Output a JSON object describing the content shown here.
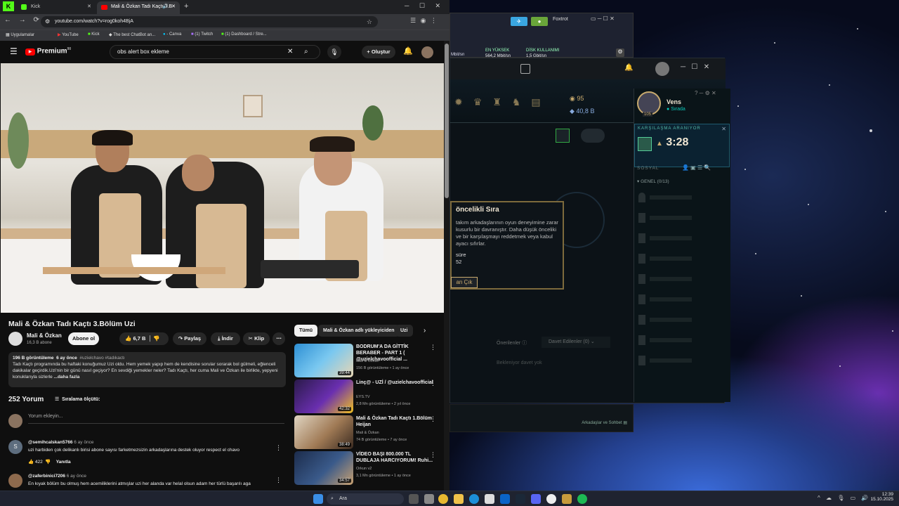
{
  "browser": {
    "tabs": [
      {
        "label": "Kick"
      },
      {
        "label": "Mali & Özkan Tadı Kaçtı 3.B"
      }
    ],
    "url": "youtube.com/watch?v=rog0koh4BjA",
    "bookmarks": [
      "Uygulamalar",
      "YouTube",
      "Kick",
      "The best ChatBot an...",
      "- Canva",
      "(1) Twitch",
      "(1) Dashboard / Stre..."
    ]
  },
  "yt": {
    "logo": "Premium",
    "logo_sup": "90",
    "search_value": "obs alert box ekleme",
    "create_label": "Oluştur",
    "video_title": "Mali & Özkan Tadı Kaçtı 3.Bölüm Uzi",
    "channel": "Mali & Özkan",
    "subs": "16,3 B abone",
    "subscribe": "Abone ol",
    "likes": "6,7 B",
    "share": "Paylaş",
    "download": "İndir",
    "clip": "Klip",
    "desc_views": "196 B görüntüleme",
    "desc_date": "6 ay önce",
    "desc_tags": "#uzielchavo #tadıkactı",
    "desc_text": "Tadı Kaçtı programında bu haftaki konuğumuz Uzi oldu. Hem yemek yapıp hem de kendisine sorular sorarak bol gülmeli, eğlenceli dakikalar geçirdik.Uzi'nin bir günü nasıl geçiyor? En sevdiği yemekler neler? Tadı Kaçtı, her cuma Mali ve Özkan ile birlikte, yepyeni konuklarıyla sizlerle",
    "desc_more": "...daha fazla",
    "comment_count": "252 Yorum",
    "sort": "Sıralama ölçütü:",
    "add_comment": "Yorum ekleyin...",
    "comments": [
      {
        "user": "@semihcalskan5766",
        "time": "6 ay önce",
        "text": "uzi harbiden çok delikanlı birisi abone sayısı farketmezsizin arkadaşlarına destek oluyor respect el chavo",
        "likes": "422",
        "reply": "Yanıtla",
        "initial": "S"
      },
      {
        "user": "@zaferbinici7206",
        "time": "6 ay önce",
        "text": "En kıyak bölüm bu olmuş hem acemiliklerini atmışlar uzi her alanda var helal olsun adam her türlü başarılı aga",
        "likes": "",
        "reply": "",
        "initial": ""
      }
    ],
    "chips": [
      "Tümü",
      "Mali & Özkan adlı yükleyiciden",
      "Uzi"
    ],
    "recs": [
      {
        "title": "BODRUM'A DA GİTTİK BERABER - PART 1 ( @uzielchavoofficial ...",
        "channel": "Mali & Özkan",
        "meta": "156 B görüntüleme • 1 ay önce",
        "dur": "39:44"
      },
      {
        "title": "Linç@ - UZİ / @uzielchavoofficial",
        "channel": "EYS.TV",
        "meta": "2,8 Mn görüntüleme • 2 yıl önce",
        "dur": "42:32"
      },
      {
        "title": "Mali & Özkan Tadı Kaçtı 1.Bölüm Heijan",
        "channel": "Mali & Özkan",
        "meta": "74 B görüntüleme • 7 ay önce",
        "dur": "38:49"
      },
      {
        "title": "VİDEO BAŞI 800.000 TL DUBLAJA HARCIYORUM! Ruhi...",
        "channel": "Orkun v2",
        "meta": "3,1 Mn görüntüleme • 1 ay önce",
        "dur": "34:57"
      }
    ]
  },
  "lol": {
    "app_title": "Foxtrot",
    "stat1_label": "EN YÜKSEK",
    "stat1_value": "564,2 Mbit/sn",
    "stat2_label": "DİSK KULLANIMI",
    "stat2_value": "1,5 Gbit/sn",
    "stat0_value": "Mbit/sn",
    "rp": "95",
    "be": "40,8 B",
    "player": "Vens",
    "status": "Sırada",
    "level": "105",
    "queue_label": "KARŞILAŞMA ARANIYOR",
    "queue_time": "3:28",
    "social": "SOSYAL",
    "group": "GENEL (0/13)",
    "popup_title": "öncelikli Sıra",
    "popup_text": "takım arkadaşlarının oyun deneyimine zarar kusurlu bir davranıştır. Daha düşük önceliki ve bir karşılaşmayı reddetmek veya kabul ayacı sıfırlar.",
    "popup_time_label": "süre",
    "popup_time": "52",
    "popup_btn": "an Çık",
    "tab_recommended": "Önerilenler",
    "tab_invited": "Davet Edilenler (0)",
    "invite_wait": "Bekleniyor davet yok",
    "friends_footer": "Arkadaşlar ve Sohbet"
  },
  "taskbar": {
    "search": "Ara",
    "time": "12:39",
    "date": "15.10.2025"
  }
}
